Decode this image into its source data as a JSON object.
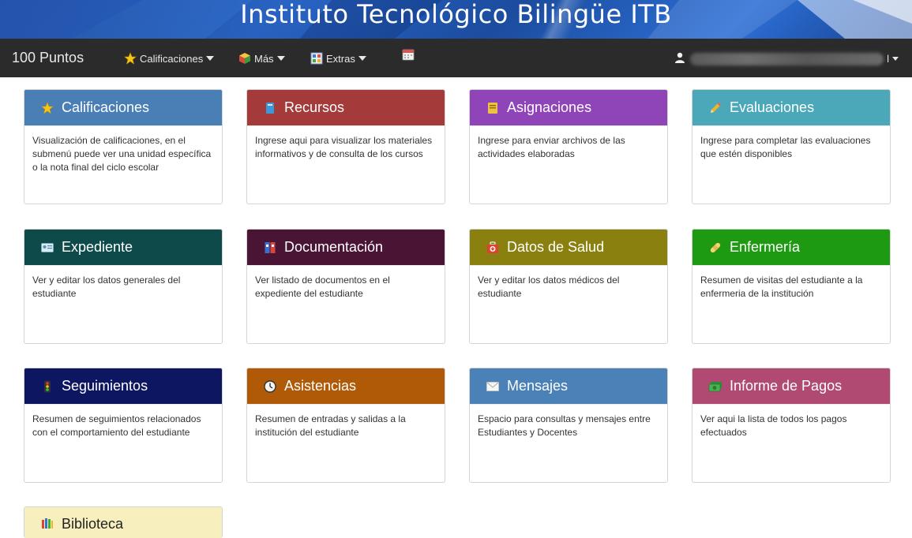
{
  "banner": {
    "title": "Instituto Tecnológico Bilingüe ITB"
  },
  "navbar": {
    "brand": "100 Puntos",
    "menus": [
      {
        "label": "Calificaciones",
        "icon": "star-icon"
      },
      {
        "label": "Más",
        "icon": "cube-icon"
      },
      {
        "label": "Extras",
        "icon": "grid-icon"
      }
    ],
    "calendar_icon": "calendar-icon",
    "user_suffix": "l"
  },
  "colors": {
    "calificaciones": "#4a7fb5",
    "recursos": "#a43a3a",
    "asignaciones": "#8f45b8",
    "evaluaciones": "#4aa8b8",
    "expediente": "#0f4a4a",
    "documentacion": "#4a1535",
    "datos_salud": "#8a8010",
    "enfermeria": "#1e9a12",
    "seguimientos": "#0d1660",
    "asistencias": "#b05a08",
    "mensajes": "#4a82b8",
    "pagos": "#b04a72",
    "biblioteca": "#f8efbe"
  },
  "cards": [
    {
      "title": "Calificaciones",
      "desc": "Visualización de calificaciones, en el submenú puede ver una unidad específica o la nota final del ciclo escolar",
      "icon": "star-icon"
    },
    {
      "title": "Recursos",
      "desc": "Ingrese aqui para visualizar los materiales informativos y de consulta de los cursos",
      "icon": "book-icon"
    },
    {
      "title": "Asignaciones",
      "desc": "Ingrese para enviar archivos de las actividades elaboradas",
      "icon": "notebook-icon"
    },
    {
      "title": "Evaluaciones",
      "desc": "Ingrese para completar las evaluaciones que estén disponibles",
      "icon": "pencil-icon"
    },
    {
      "title": "Expediente",
      "desc": "Ver y editar los datos generales del estudiante",
      "icon": "id-card-icon"
    },
    {
      "title": "Documentación",
      "desc": "Ver listado de documentos en el expediente del estudiante",
      "icon": "binders-icon"
    },
    {
      "title": "Datos de Salud",
      "desc": "Ver y editar los datos médicos del estudiante",
      "icon": "medkit-icon"
    },
    {
      "title": "Enfermería",
      "desc": "Resumen de visitas del estudiante a la enfermeria de la institución",
      "icon": "bandage-icon"
    },
    {
      "title": "Seguimientos",
      "desc": "Resumen de seguimientos relacionados con el comportamiento del estudiante",
      "icon": "traffic-light-icon"
    },
    {
      "title": "Asistencias",
      "desc": "Resumen de entradas y salidas a la institución del estudiante",
      "icon": "clock-icon"
    },
    {
      "title": "Mensajes",
      "desc": "Espacio para consultas y mensajes entre Estudiantes y Docentes",
      "icon": "envelope-icon"
    },
    {
      "title": "Informe de Pagos",
      "desc": "Ver aqui la lista de todos los pagos efectuados",
      "icon": "money-icon"
    },
    {
      "title": "Biblioteca",
      "desc": "",
      "icon": "library-icon"
    }
  ]
}
